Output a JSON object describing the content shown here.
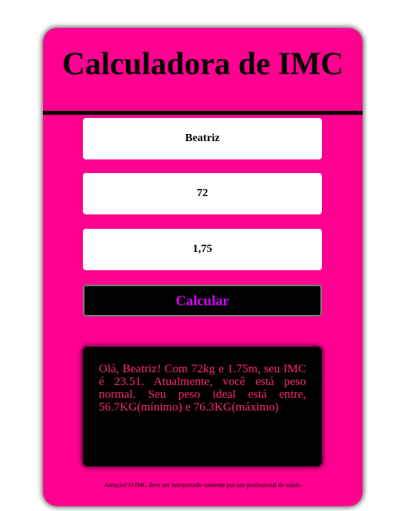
{
  "header": {
    "title": "Calculadora de IMC"
  },
  "form": {
    "name_value": "Beatriz",
    "weight_value": "72",
    "height_value": "1,75",
    "calculate_label": "Calcular"
  },
  "result": {
    "message": "Olá, Beatriz! Com 72kg e 1.75m, seu IMC é 23.51. Atualmente, você está peso normal. Seu peso ideal está entre, 56.7KG(mínimo) e 76.3KG(máximo)"
  },
  "footer": {
    "note": "Atenção! O IMC deve ser interpretado somente por um profissional de saúde."
  },
  "colors": {
    "card_background": "#ff0090",
    "button_text": "#d400ff",
    "result_text": "#ff2a6d"
  }
}
